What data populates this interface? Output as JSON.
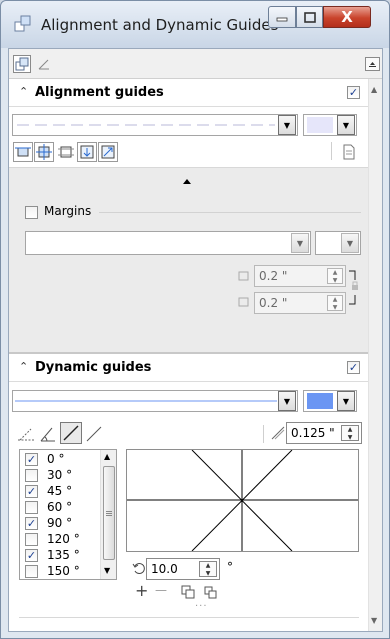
{
  "window": {
    "title": "Alignment and Dynamic Guides",
    "close_label": "X"
  },
  "alignment_guides": {
    "header": "Alignment guides",
    "enabled": true,
    "line_color": "#e6e6fa",
    "margins_label": "Margins",
    "margins_checked": false,
    "margin_h_value": "0.2 \"",
    "margin_v_value": "0.2 \""
  },
  "dynamic_guides": {
    "header": "Dynamic guides",
    "enabled": true,
    "line_color": "#6b96f3",
    "snap_offset_value": "0.125 \"",
    "angles": [
      {
        "label": "0 °",
        "checked": true
      },
      {
        "label": "30 °",
        "checked": false
      },
      {
        "label": "45 °",
        "checked": true
      },
      {
        "label": "60 °",
        "checked": false
      },
      {
        "label": "90 °",
        "checked": true
      },
      {
        "label": "120 °",
        "checked": false
      },
      {
        "label": "135 °",
        "checked": true
      },
      {
        "label": "150 °",
        "checked": false
      }
    ],
    "rotation_value": "10.0",
    "rotation_unit": "°",
    "add_label": "+",
    "remove_label": "—",
    "more_label": "..."
  },
  "colors": {
    "check_mark": "#1b3f91",
    "close_button": "#c9432c"
  }
}
